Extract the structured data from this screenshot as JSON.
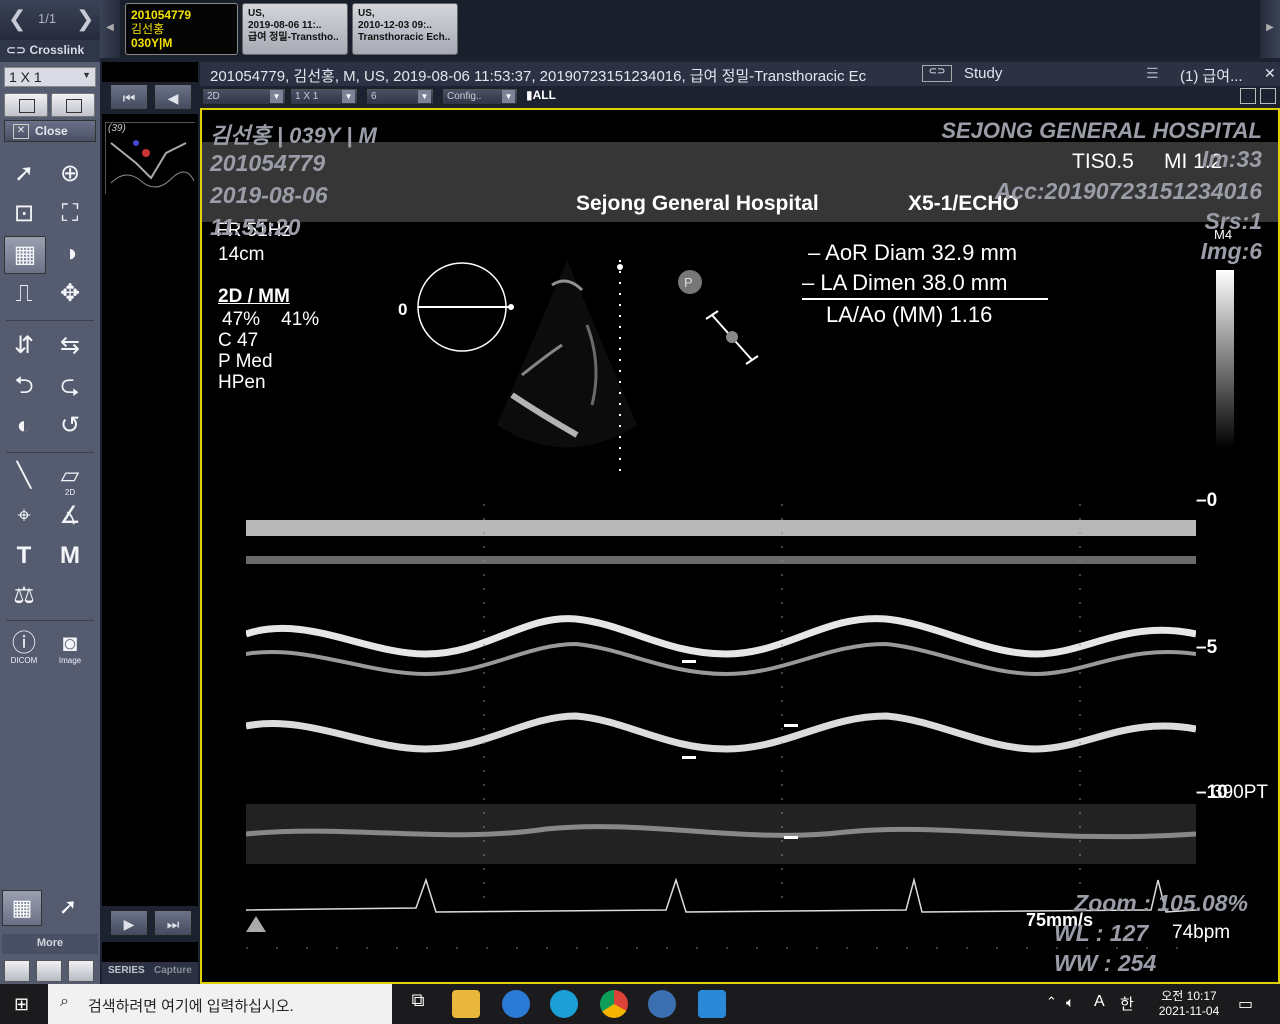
{
  "pager": {
    "label": "1/1"
  },
  "crosslink": {
    "label": "Crosslink"
  },
  "layout": {
    "value": "1 X 1"
  },
  "close": {
    "label": "Close"
  },
  "study_tabs": [
    {
      "id": "201054779",
      "name": "김선홍",
      "age_sex": "030Y|M"
    },
    {
      "modality": "US,",
      "date": "2019-08-06 11:..",
      "desc": "급여 정밀-Transtho.."
    },
    {
      "modality": "US,",
      "date": "2010-12-03 09:..",
      "desc": "Transthoracic Ech.."
    }
  ],
  "header": {
    "text": "201054779, 김선홍, M, US, 2019-08-06 11:53:37, 20190723151234016, 급여 정밀-Transthoracic Ec",
    "link": "⊂⊃",
    "study": "Study",
    "series": "(1) 급여..."
  },
  "toolbar2": {
    "mode": "2D",
    "layout": "1 X 1",
    "count": "6",
    "config": "Config..",
    "all": "ALL"
  },
  "thumbnail": {
    "label": "(39)"
  },
  "series_bar": {
    "series": "SERIES",
    "capture": "Capture"
  },
  "more": {
    "label": "More"
  },
  "tools": {
    "dicom": "DICOM",
    "image": "Image",
    "ruler_2d": "2D"
  },
  "overlay": {
    "patient": "김선홍 | 039Y | M",
    "id": "201054779",
    "date": "2019-08-06",
    "time": "11:55:20",
    "hospital_top": "SEJONG GENERAL HOSPITAL",
    "im": "Im:33",
    "acc": "Acc:20190723151234016",
    "srs": "Srs:1",
    "img": "Img:6",
    "zoom": "Zoom : 105.08%",
    "wl": "WL : 127",
    "ww": "WW : 254"
  },
  "device": {
    "hospital": "Sejong General Hospital",
    "probe": "X5-1/ECHO",
    "tis": "TIS0.5",
    "mi": "MI 1.2",
    "fr": "FR 51Hz",
    "depth": "14cm",
    "mode": "2D / MM",
    "gain": "47%    41%",
    "c": "C 47",
    "p": "P Med",
    "hpen": "HPen",
    "m4": "M4",
    "angle": "0",
    "speed": "75mm/s",
    "bpm": "74bpm",
    "pt": "390PT",
    "depth_labels": [
      "0",
      "5",
      "10"
    ]
  },
  "measurements": [
    {
      "label": "AoR Diam",
      "value": "32.9 mm"
    },
    {
      "label": "LA Dimen",
      "value": "38.0 mm"
    },
    {
      "label": "LA/Ao (MM)",
      "value": "1.16"
    }
  ],
  "taskbar": {
    "search": "검색하려면 여기에 입력하십시오.",
    "time": "오전 10:17",
    "date": "2021-11-04",
    "ime1": "A",
    "ime2": "한"
  },
  "colors": {
    "viewport_border": "#e0d200",
    "active_tab_text": "#f3e200",
    "panel": "#555c70"
  }
}
